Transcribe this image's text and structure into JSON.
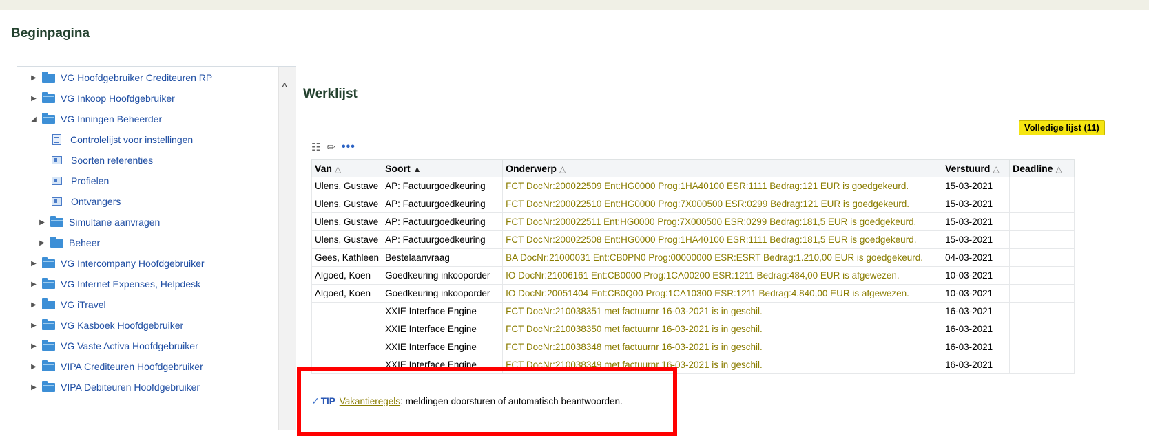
{
  "page": {
    "title": "Beginpagina"
  },
  "navigator": {
    "items": [
      {
        "label": "VG Hoofdgebruiker Crediteuren RP",
        "type": "folder",
        "expanded": false,
        "level": 0
      },
      {
        "label": "VG Inkoop Hoofdgebruiker",
        "type": "folder",
        "expanded": false,
        "level": 0
      },
      {
        "label": "VG Inningen Beheerder",
        "type": "folder",
        "expanded": true,
        "level": 0
      },
      {
        "label": "Controlelijst voor instellingen",
        "type": "document",
        "level": 1
      },
      {
        "label": "Soorten referenties",
        "type": "form",
        "level": 1
      },
      {
        "label": "Profielen",
        "type": "form",
        "level": 1
      },
      {
        "label": "Ontvangers",
        "type": "form",
        "level": 1
      },
      {
        "label": "Simultane aanvragen",
        "type": "folder",
        "expanded": false,
        "level": 1
      },
      {
        "label": "Beheer",
        "type": "folder",
        "expanded": false,
        "level": 1
      },
      {
        "label": "VG Intercompany Hoofdgebruiker",
        "type": "folder",
        "expanded": false,
        "level": 0
      },
      {
        "label": "VG Internet Expenses, Helpdesk",
        "type": "folder",
        "expanded": false,
        "level": 0
      },
      {
        "label": "VG iTravel",
        "type": "folder",
        "expanded": false,
        "level": 0
      },
      {
        "label": "VG Kasboek Hoofdgebruiker",
        "type": "folder",
        "expanded": false,
        "level": 0
      },
      {
        "label": "VG Vaste Activa Hoofdgebruiker",
        "type": "folder",
        "expanded": false,
        "level": 0
      },
      {
        "label": "VIPA Crediteuren Hoofdgebruiker",
        "type": "folder",
        "expanded": false,
        "level": 0
      },
      {
        "label": "VIPA Debiteuren Hoofdgebruiker",
        "type": "folder",
        "expanded": false,
        "level": 0
      }
    ]
  },
  "worklist": {
    "title": "Werklijst",
    "full_list_label": "Volledige lijst (11)",
    "columns": {
      "van": "Van",
      "soort": "Soort",
      "onderwerp": "Onderwerp",
      "verstuurd": "Verstuurd",
      "deadline": "Deadline"
    },
    "rows": [
      {
        "van": "Ulens, Gustave",
        "soort": "AP: Factuurgoedkeuring",
        "onderwerp": "FCT DocNr:200022509 Ent:HG0000 Prog:1HA40100 ESR:1111 Bedrag:121 EUR is goedgekeurd.",
        "verstuurd": "15-03-2021",
        "deadline": ""
      },
      {
        "van": "Ulens, Gustave",
        "soort": "AP: Factuurgoedkeuring",
        "onderwerp": "FCT DocNr:200022510 Ent:HG0000 Prog:7X000500 ESR:0299 Bedrag:121 EUR is goedgekeurd.",
        "verstuurd": "15-03-2021",
        "deadline": ""
      },
      {
        "van": "Ulens, Gustave",
        "soort": "AP: Factuurgoedkeuring",
        "onderwerp": "FCT DocNr:200022511 Ent:HG0000 Prog:7X000500 ESR:0299 Bedrag:181,5 EUR is goedgekeurd.",
        "verstuurd": "15-03-2021",
        "deadline": ""
      },
      {
        "van": "Ulens, Gustave",
        "soort": "AP: Factuurgoedkeuring",
        "onderwerp": "FCT DocNr:200022508 Ent:HG0000 Prog:1HA40100 ESR:1111 Bedrag:181,5 EUR is goedgekeurd.",
        "verstuurd": "15-03-2021",
        "deadline": ""
      },
      {
        "van": "Gees, Kathleen",
        "soort": "Bestelaanvraag",
        "onderwerp": "BA DocNr:21000031 Ent:CB0PN0 Prog:00000000 ESR:ESRT Bedrag:1.210,00 EUR is goedgekeurd.",
        "verstuurd": "04-03-2021",
        "deadline": ""
      },
      {
        "van": "Algoed, Koen",
        "soort": "Goedkeuring inkooporder",
        "onderwerp": "IO DocNr:21006161 Ent:CB0000 Prog:1CA00200 ESR:1211 Bedrag:484,00 EUR is afgewezen.",
        "verstuurd": "10-03-2021",
        "deadline": ""
      },
      {
        "van": "Algoed, Koen",
        "soort": "Goedkeuring inkooporder",
        "onderwerp": "IO DocNr:20051404 Ent:CB0Q00 Prog:1CA10300 ESR:1211 Bedrag:4.840,00 EUR is afgewezen.",
        "verstuurd": "10-03-2021",
        "deadline": ""
      },
      {
        "van": "",
        "soort": "XXIE Interface Engine",
        "onderwerp": "FCT DocNr:210038351 met factuurnr 16-03-2021 is in geschil.",
        "verstuurd": "16-03-2021",
        "deadline": ""
      },
      {
        "van": "",
        "soort": "XXIE Interface Engine",
        "onderwerp": "FCT DocNr:210038350 met factuurnr 16-03-2021 is in geschil.",
        "verstuurd": "16-03-2021",
        "deadline": ""
      },
      {
        "van": "",
        "soort": "XXIE Interface Engine",
        "onderwerp": "FCT DocNr:210038348 met factuurnr 16-03-2021 is in geschil.",
        "verstuurd": "16-03-2021",
        "deadline": ""
      },
      {
        "van": "",
        "soort": "XXIE Interface Engine",
        "onderwerp": "FCT DocNr:210038349 met factuurnr 16-03-2021 is in geschil.",
        "verstuurd": "16-03-2021",
        "deadline": ""
      }
    ]
  },
  "tip": {
    "label": "TIP",
    "link_text": "Vakantieregels",
    "text": ": meldingen doorsturen of automatisch beantwoorden."
  },
  "icons": {
    "folder": "folder-icon",
    "tree_collapsed": "triangle-right-icon",
    "tree_expanded": "triangle-down-icon",
    "checklist": "document-icon",
    "form": "form-icon",
    "tip": "checkmark-circle-icon"
  },
  "colors": {
    "title": "#23412e",
    "link": "#1f4ea3",
    "subject": "#8a7c00",
    "button": "#f5e512",
    "highlight": "#ff0000"
  }
}
